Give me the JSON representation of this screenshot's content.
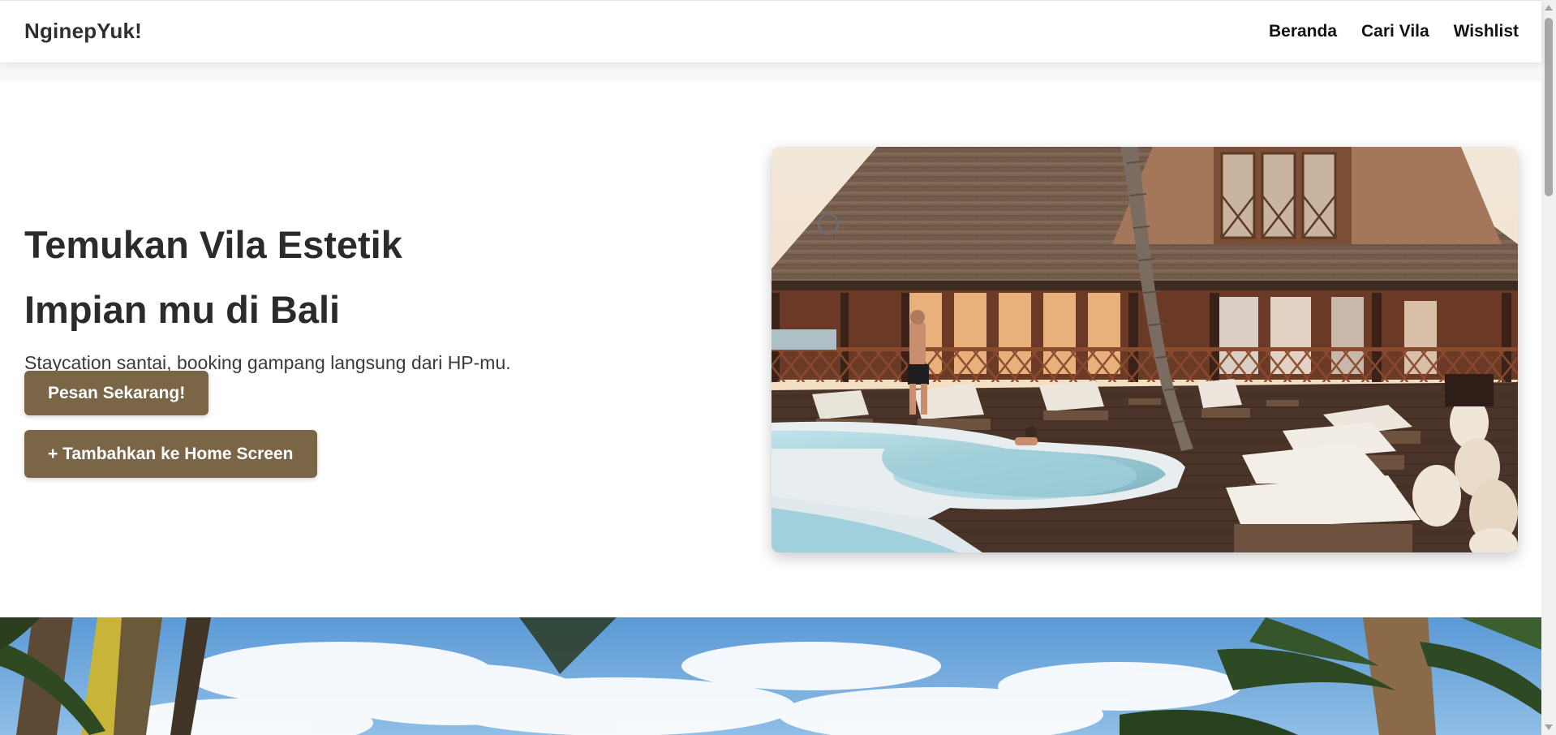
{
  "header": {
    "brand": "NginepYuk!",
    "nav": [
      "Beranda",
      "Cari Vila",
      "Wishlist"
    ]
  },
  "hero": {
    "title_line1": "Temukan Vila Estetik",
    "title_line2": "Impian mu di Bali",
    "subtitle": "Staycation santai, booking gampang langsung dari HP-mu.",
    "primary_button": "Pesan Sekarang!",
    "secondary_button": "+ Tambahkan ke Home Screen"
  },
  "colors": {
    "accent": "#7a6647",
    "text": "#2b2b2b",
    "background": "#ffffff"
  }
}
